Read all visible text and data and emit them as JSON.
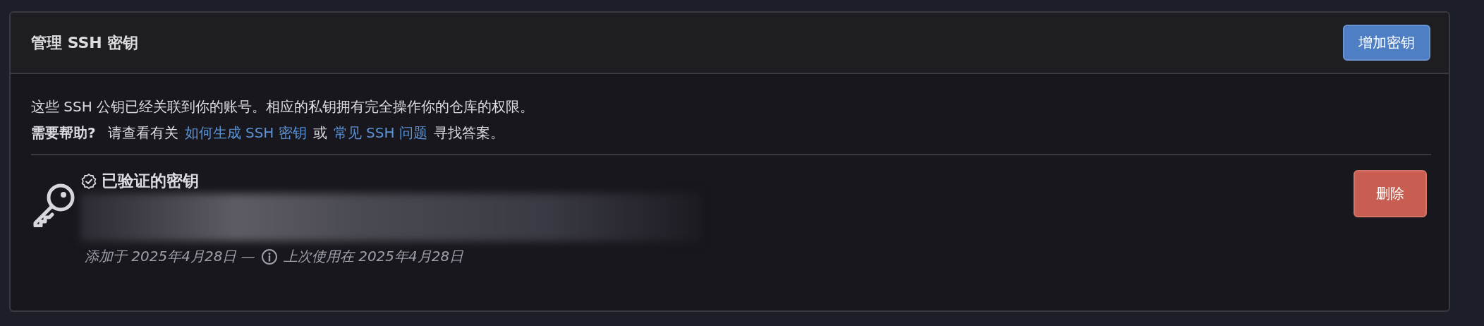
{
  "panel": {
    "title": "管理 SSH 密钥",
    "add_button": "增加密钥"
  },
  "description": {
    "line_1": "这些 SSH 公钥已经关联到你的账号。相应的私钥拥有完全操作你的仓库的权限。",
    "help_label": "需要帮助?",
    "help_text": "请查看有关",
    "link_1": "如何生成 SSH 密钥",
    "joiner": "或",
    "link_2": "常见 SSH 问题",
    "help_end": "寻找答案。"
  },
  "keys": [
    {
      "title": "已验证的密钥",
      "verified": true,
      "added": "添加于 2025年4月28日 —",
      "last_used": "上次使用在 2025年4月28日",
      "delete_button": "删除"
    }
  ]
}
